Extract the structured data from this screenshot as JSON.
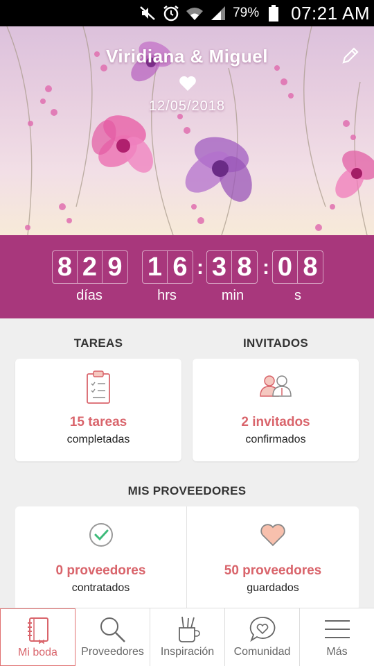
{
  "status_bar": {
    "battery": "79%",
    "time": "07:21 AM",
    "icons": [
      "mute-icon",
      "alarm-icon",
      "wifi-icon",
      "signal-icon",
      "battery-icon"
    ]
  },
  "header": {
    "couple": "Viridiana & Miguel",
    "date": "12/05/2018"
  },
  "countdown": {
    "days": [
      "8",
      "2",
      "9"
    ],
    "hours": [
      "1",
      "6"
    ],
    "minutes": [
      "3",
      "8"
    ],
    "seconds": [
      "0",
      "8"
    ],
    "labels": {
      "days": "días",
      "hours": "hrs",
      "minutes": "min",
      "seconds": "s"
    }
  },
  "tareas": {
    "title": "TAREAS",
    "count": "15 tareas",
    "sub": "completadas"
  },
  "invitados": {
    "title": "INVITADOS",
    "count": "2 invitados",
    "sub": "confirmados"
  },
  "proveedores": {
    "title": "MIS PROVEEDORES",
    "contratados_count": "0 proveedores",
    "contratados_sub": "contratados",
    "guardados_count": "50 proveedores",
    "guardados_sub": "guardados"
  },
  "nav": {
    "items": [
      {
        "label": "Mi boda",
        "icon": "notebook-icon"
      },
      {
        "label": "Proveedores",
        "icon": "search-icon"
      },
      {
        "label": "Inspiración",
        "icon": "brush-cup-icon"
      },
      {
        "label": "Comunidad",
        "icon": "chat-heart-icon"
      },
      {
        "label": "Más",
        "icon": "menu-icon"
      }
    ]
  },
  "colors": {
    "accent": "#a8377c",
    "highlight": "#d9646b"
  }
}
